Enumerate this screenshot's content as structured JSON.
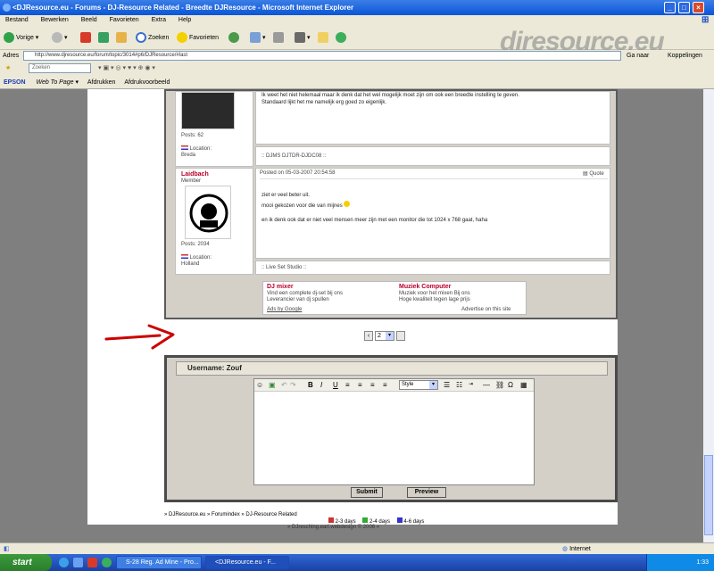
{
  "window": {
    "title": "<DJResource.eu - Forums - DJ-Resource Related - Breedte DJResource - Microsoft Internet Explorer"
  },
  "menu": [
    "Bestand",
    "Bewerken",
    "Beeld",
    "Favorieten",
    "Extra",
    "Help"
  ],
  "toolbar": {
    "back": "Vorige",
    "search": "Zoeken",
    "favorites": "Favorieten"
  },
  "address": {
    "label": "Adres",
    "url": "http://www.djresource.eu/forum/topic/3014#p6/DJResource/#last",
    "go": "Ga naar",
    "links": "Koppelingen"
  },
  "linkbar": {
    "search_placeholder": "Zoeken"
  },
  "epson": {
    "brand": "EPSON",
    "web_to_page": "Web To Page",
    "print": "Afdrukken",
    "preview": "Afdrukvoorbeeld"
  },
  "post1": {
    "text1": "Ik weet het niet helemaal maar ik denk dat het wel mogelijk moet zijn om ook een breedte instelling te geven.",
    "text2": "Standaard lijkt het me namelijk erg goed zo eigenlijk.",
    "author_posts": "Posts: 62",
    "author_location": "Location:",
    "author_loc_val": "Breda",
    "signature": ":: DJMS DJTDR-DJDC08 ::"
  },
  "post2": {
    "author": "Laidbach",
    "rank": "Member",
    "posted": "Posted on 05-03-2007 20:54:58",
    "quote": "Quote",
    "text1": "ziet er veel beter uit.",
    "text2": "mooi gekozen voor die van mijnes",
    "text3": "en ik denk ook dat er niet veel mensen meer zijn met een monitor die tot 1024 x 768 gaat, haha",
    "author_posts": "Posts: 2034",
    "author_location": "Location:",
    "author_loc_val": "Holland",
    "signature": ":: Live Set Studio ::"
  },
  "ads": {
    "ad1_title": "DJ mixer",
    "ad1_l1": "Vind een complete dj-set bij ons",
    "ad1_l2": "Leverancier van dj spullen",
    "ad2_title": "Muziek Computer",
    "ad2_l1": "Muziek voor het mixen Bij ons",
    "ad2_l2": "Hoge kwaliteit tegen lage prijs",
    "ads_by": "Ads by Google",
    "advertise": "Advertise on this site"
  },
  "pager": {
    "value": "2"
  },
  "reply": {
    "header": "Username: Zouf",
    "style_label": "Style",
    "submit": "Submit",
    "preview": "Preview"
  },
  "footer": {
    "breadcrumb": "» DJResource.eu » Forumindex » DJ-Resource Related",
    "d1": "2-3 days",
    "d2": "2-4 days",
    "d3": "4-6 days",
    "copyright": "» DJresching.earl.webdesign © 2006 «"
  },
  "statusbar": {
    "zone": "Internet"
  },
  "taskbar": {
    "start": "start",
    "task1": "S-28 Reg. Ad Mine - Pro...",
    "task2": "<DJResource.eu - F...",
    "time": "1:33"
  },
  "watermark": "djresource.eu",
  "colors": {
    "accent_red": "#cc0000",
    "link_red": "#b8002a",
    "xp_blue": "#0a55d6"
  }
}
